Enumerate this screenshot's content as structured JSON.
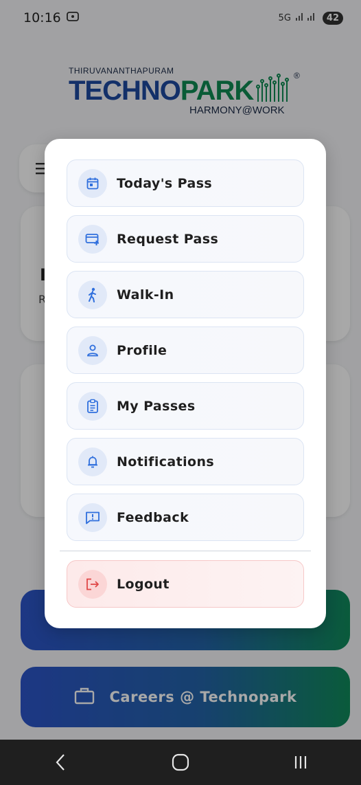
{
  "status_bar": {
    "time": "10:16",
    "network": "5G",
    "battery": "42"
  },
  "logo": {
    "top_text": "THIRUVANANTHAPURAM",
    "main_text_a": "TECHNO",
    "main_text_b": "PARK",
    "registered": "®",
    "tagline": "HARMONY@WORK"
  },
  "background": {
    "greeting_letter": "I",
    "greeting_sub": "R",
    "cta_primary_label": "",
    "cta_careers_label": "Careers @ Technopark"
  },
  "menu": {
    "items": [
      {
        "label": "Today's Pass",
        "icon": "calendar-icon"
      },
      {
        "label": "Request Pass",
        "icon": "card-add-icon"
      },
      {
        "label": "Walk-In",
        "icon": "walking-icon"
      },
      {
        "label": "Profile",
        "icon": "person-icon"
      },
      {
        "label": "My Passes",
        "icon": "clipboard-icon"
      },
      {
        "label": "Notifications",
        "icon": "bell-icon"
      },
      {
        "label": "Feedback",
        "icon": "feedback-icon"
      }
    ],
    "logout_label": "Logout",
    "logout_icon": "logout-icon"
  },
  "colors": {
    "accent": "#2f6fdd",
    "logout": "#e04848",
    "brand_blue": "#1e4aa0",
    "brand_green": "#0f8a52"
  }
}
